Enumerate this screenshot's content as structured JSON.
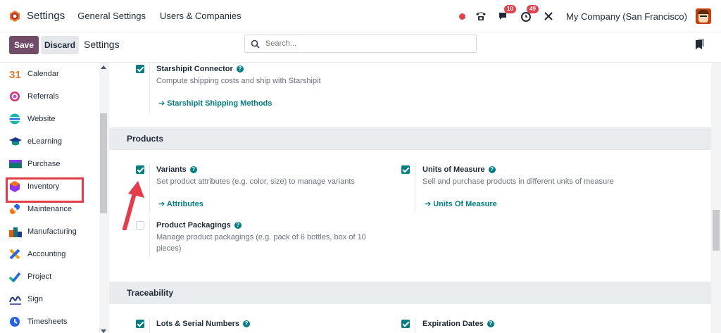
{
  "topbar": {
    "app_title": "Settings",
    "menu": [
      "General Settings",
      "Users & Companies"
    ],
    "messages_badge": "10",
    "activities_badge": "49",
    "company": "My Company (San Francisco)"
  },
  "control": {
    "save": "Save",
    "discard": "Discard",
    "title": "Settings",
    "search_placeholder": "Search..."
  },
  "sidebar": {
    "items": [
      {
        "label": "Calendar",
        "icon": "calendar-icon",
        "color": "#e07a2e"
      },
      {
        "label": "Referrals",
        "icon": "referrals-icon",
        "color": "#d6336c"
      },
      {
        "label": "Website",
        "icon": "website-icon",
        "color": "#14b8a6"
      },
      {
        "label": "eLearning",
        "icon": "elearning-icon",
        "color": "#1e3a8a"
      },
      {
        "label": "Purchase",
        "icon": "purchase-icon",
        "color": "#0f766e"
      },
      {
        "label": "Inventory",
        "icon": "inventory-icon",
        "color": "#9333ea"
      },
      {
        "label": "Maintenance",
        "icon": "maintenance-icon",
        "color": "#2563eb"
      },
      {
        "label": "Manufacturing",
        "icon": "manufacturing-icon",
        "color": "#ea580c"
      },
      {
        "label": "Accounting",
        "icon": "accounting-icon",
        "color": "#f59e0b"
      },
      {
        "label": "Project",
        "icon": "project-icon",
        "color": "#10b981"
      },
      {
        "label": "Sign",
        "icon": "sign-icon",
        "color": "#1e3a8a"
      },
      {
        "label": "Timesheets",
        "icon": "timesheets-icon",
        "color": "#2563eb"
      }
    ],
    "highlighted": "Inventory"
  },
  "content": {
    "starshipit": {
      "title": "Starshipit Connector",
      "desc": "Compute shipping costs and ship with Starshipit",
      "link": "Starshipit Shipping Methods",
      "checked": true
    },
    "products_header": "Products",
    "variants": {
      "title": "Variants",
      "desc": "Set product attributes (e.g. color, size) to manage variants",
      "link": "Attributes",
      "checked": true
    },
    "uom": {
      "title": "Units of Measure",
      "desc": "Sell and purchase products in different units of measure",
      "link": "Units Of Measure",
      "checked": true
    },
    "packagings": {
      "title": "Product Packagings",
      "desc": "Manage product packagings (e.g. pack of 6 bottles, box of 10 pieces)",
      "checked": false
    },
    "traceability_header": "Traceability",
    "lots": {
      "title": "Lots & Serial Numbers",
      "checked": true
    },
    "expiration": {
      "title": "Expiration Dates",
      "checked": true
    }
  },
  "colors": {
    "accent": "#017e84",
    "brand": "#714b67",
    "annotation": "#e33d4b"
  }
}
